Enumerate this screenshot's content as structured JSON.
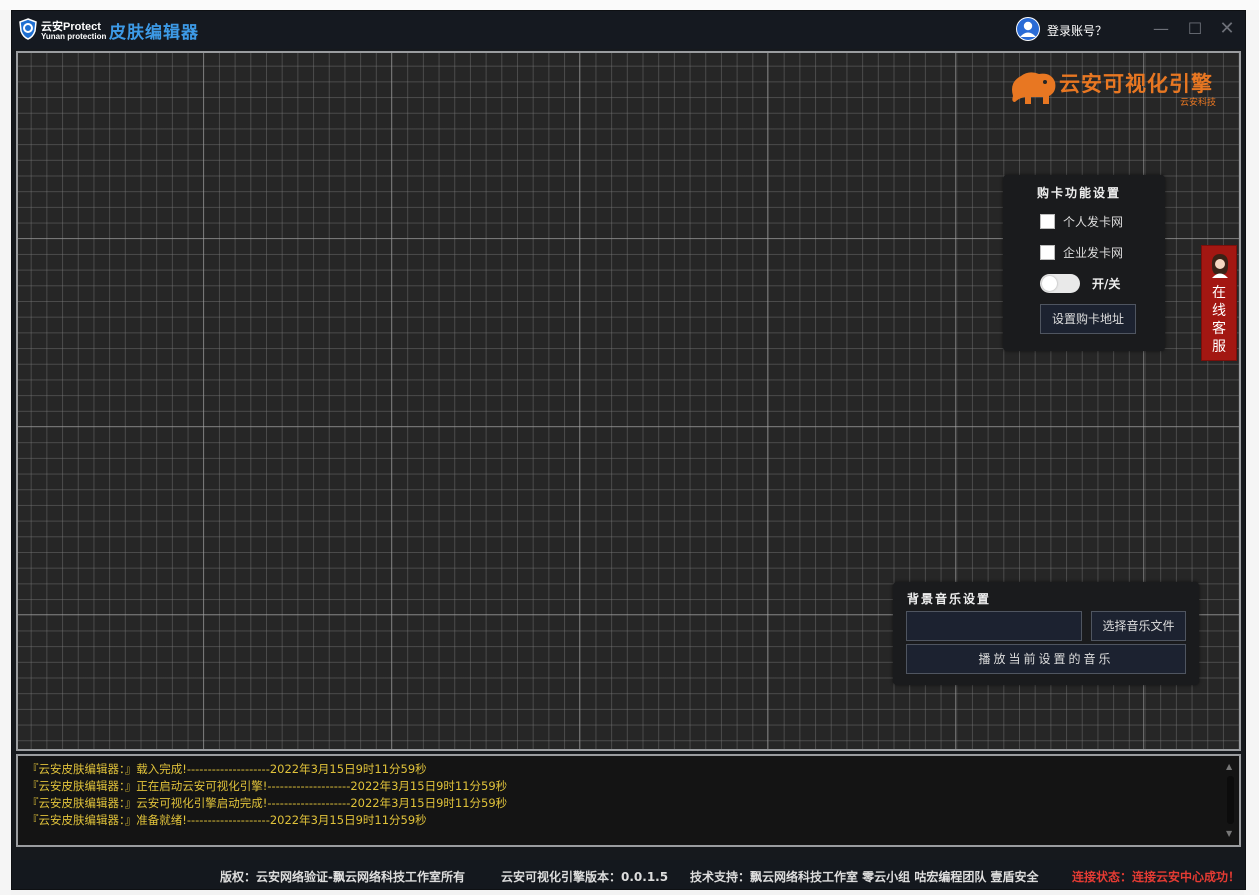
{
  "app": {
    "logo_main": "云安Protect",
    "logo_sub": "Yunan protection",
    "title": "皮肤编辑器",
    "login": "登录账号？"
  },
  "window_controls": {
    "minimize": "—",
    "maximize": "☐",
    "close": "✕"
  },
  "brand": {
    "main": "云安可视化引擎",
    "sub": "云安科技",
    "color": "#e87722"
  },
  "card_settings": {
    "title": "购卡功能设置",
    "personal": "个人发卡网",
    "enterprise": "企业发卡网",
    "toggle_label": "开/关",
    "set_url_button": "设置购卡地址"
  },
  "online_service": {
    "label_chars": [
      "在",
      "线",
      "客",
      "服"
    ]
  },
  "music_settings": {
    "title": "背景音乐设置",
    "file_path": "",
    "choose_button": "选择音乐文件",
    "play_button": "播放当前设置的音乐"
  },
  "log": [
    "『云安皮肤编辑器：』载入完成!--------------------2022年3月15日9时11分59秒",
    "『云安皮肤编辑器：』正在启动云安可视化引擎!--------------------2022年3月15日9时11分59秒",
    "『云安皮肤编辑器：』云安可视化引擎启动完成!--------------------2022年3月15日9时11分59秒",
    "『云安皮肤编辑器：』准备就绪!--------------------2022年3月15日9时11分59秒"
  ],
  "statusbar": {
    "copyright": "版权：云安网络验证-飘云网络科技工作室所有",
    "version": "云安可视化引擎版本：0.0.1.5",
    "support": "技术支持：飘云网络科技工作室 零云小组 咕宏编程团队 壹盾安全",
    "connection": "连接状态：连接云安中心成功！",
    "connection_color": "#e53b33"
  },
  "colors": {
    "accent": "#3d9ae6",
    "log_text": "#e0c23a",
    "service_tab": "#a31712"
  }
}
